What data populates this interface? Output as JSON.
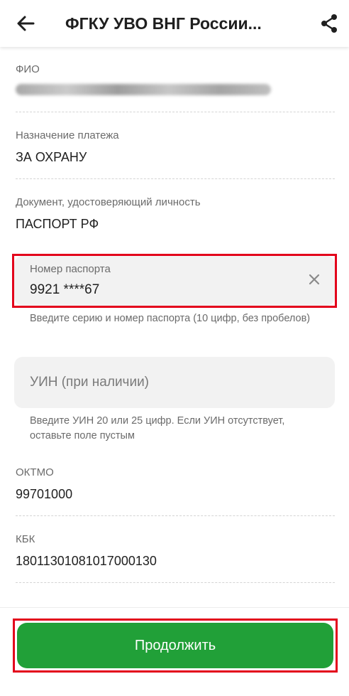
{
  "header": {
    "title": "ФГКУ УВО ВНГ России...",
    "back_icon": "arrow-left-icon",
    "share_icon": "share-icon"
  },
  "fields": {
    "fio_label": "ФИО",
    "purpose_label": "Назначение платежа",
    "purpose_value": "ЗА ОХРАНУ",
    "document_label": "Документ, удостоверяющий личность",
    "document_value": "ПАСПОРТ РФ",
    "oktmo_label": "ОКТМО",
    "oktmo_value": "99701000",
    "kbk_label": "КБК",
    "kbk_value": "18011301081017000130"
  },
  "passport": {
    "label": "Номер паспорта",
    "value": "9921 ****67",
    "hint": "Введите серию и номер паспорта (10 цифр, без пробелов)"
  },
  "uin": {
    "placeholder": "УИН (при наличии)",
    "hint": "Введите УИН 20 или 25 цифр. Если УИН отсутствует, оставьте поле пустым"
  },
  "footer": {
    "continue_label": "Продолжить"
  },
  "colors": {
    "accent_green": "#21a038",
    "highlight_red": "#e3001b",
    "input_bg": "#f2f2f2"
  }
}
